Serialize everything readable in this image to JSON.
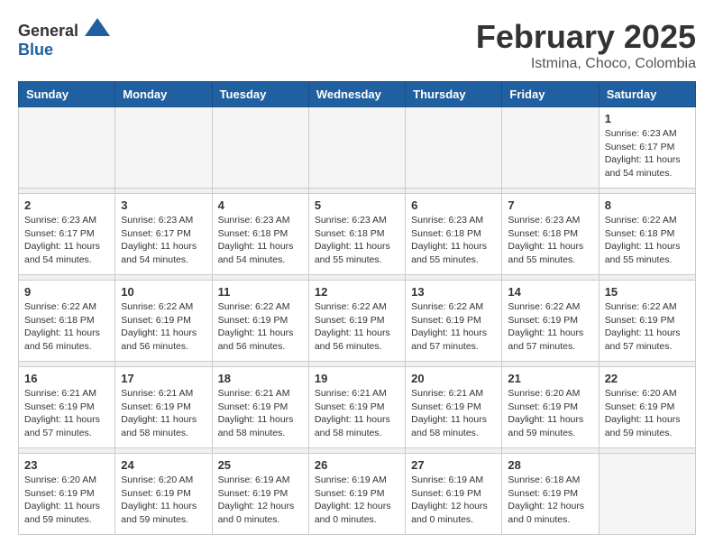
{
  "header": {
    "logo_general": "General",
    "logo_blue": "Blue",
    "title": "February 2025",
    "subtitle": "Istmina, Choco, Colombia"
  },
  "weekdays": [
    "Sunday",
    "Monday",
    "Tuesday",
    "Wednesday",
    "Thursday",
    "Friday",
    "Saturday"
  ],
  "weeks": [
    {
      "days": [
        {
          "num": "",
          "info": ""
        },
        {
          "num": "",
          "info": ""
        },
        {
          "num": "",
          "info": ""
        },
        {
          "num": "",
          "info": ""
        },
        {
          "num": "",
          "info": ""
        },
        {
          "num": "",
          "info": ""
        },
        {
          "num": "1",
          "info": "Sunrise: 6:23 AM\nSunset: 6:17 PM\nDaylight: 11 hours\nand 54 minutes."
        }
      ]
    },
    {
      "days": [
        {
          "num": "2",
          "info": "Sunrise: 6:23 AM\nSunset: 6:17 PM\nDaylight: 11 hours\nand 54 minutes."
        },
        {
          "num": "3",
          "info": "Sunrise: 6:23 AM\nSunset: 6:17 PM\nDaylight: 11 hours\nand 54 minutes."
        },
        {
          "num": "4",
          "info": "Sunrise: 6:23 AM\nSunset: 6:18 PM\nDaylight: 11 hours\nand 54 minutes."
        },
        {
          "num": "5",
          "info": "Sunrise: 6:23 AM\nSunset: 6:18 PM\nDaylight: 11 hours\nand 55 minutes."
        },
        {
          "num": "6",
          "info": "Sunrise: 6:23 AM\nSunset: 6:18 PM\nDaylight: 11 hours\nand 55 minutes."
        },
        {
          "num": "7",
          "info": "Sunrise: 6:23 AM\nSunset: 6:18 PM\nDaylight: 11 hours\nand 55 minutes."
        },
        {
          "num": "8",
          "info": "Sunrise: 6:22 AM\nSunset: 6:18 PM\nDaylight: 11 hours\nand 55 minutes."
        }
      ]
    },
    {
      "days": [
        {
          "num": "9",
          "info": "Sunrise: 6:22 AM\nSunset: 6:18 PM\nDaylight: 11 hours\nand 56 minutes."
        },
        {
          "num": "10",
          "info": "Sunrise: 6:22 AM\nSunset: 6:19 PM\nDaylight: 11 hours\nand 56 minutes."
        },
        {
          "num": "11",
          "info": "Sunrise: 6:22 AM\nSunset: 6:19 PM\nDaylight: 11 hours\nand 56 minutes."
        },
        {
          "num": "12",
          "info": "Sunrise: 6:22 AM\nSunset: 6:19 PM\nDaylight: 11 hours\nand 56 minutes."
        },
        {
          "num": "13",
          "info": "Sunrise: 6:22 AM\nSunset: 6:19 PM\nDaylight: 11 hours\nand 57 minutes."
        },
        {
          "num": "14",
          "info": "Sunrise: 6:22 AM\nSunset: 6:19 PM\nDaylight: 11 hours\nand 57 minutes."
        },
        {
          "num": "15",
          "info": "Sunrise: 6:22 AM\nSunset: 6:19 PM\nDaylight: 11 hours\nand 57 minutes."
        }
      ]
    },
    {
      "days": [
        {
          "num": "16",
          "info": "Sunrise: 6:21 AM\nSunset: 6:19 PM\nDaylight: 11 hours\nand 57 minutes."
        },
        {
          "num": "17",
          "info": "Sunrise: 6:21 AM\nSunset: 6:19 PM\nDaylight: 11 hours\nand 58 minutes."
        },
        {
          "num": "18",
          "info": "Sunrise: 6:21 AM\nSunset: 6:19 PM\nDaylight: 11 hours\nand 58 minutes."
        },
        {
          "num": "19",
          "info": "Sunrise: 6:21 AM\nSunset: 6:19 PM\nDaylight: 11 hours\nand 58 minutes."
        },
        {
          "num": "20",
          "info": "Sunrise: 6:21 AM\nSunset: 6:19 PM\nDaylight: 11 hours\nand 58 minutes."
        },
        {
          "num": "21",
          "info": "Sunrise: 6:20 AM\nSunset: 6:19 PM\nDaylight: 11 hours\nand 59 minutes."
        },
        {
          "num": "22",
          "info": "Sunrise: 6:20 AM\nSunset: 6:19 PM\nDaylight: 11 hours\nand 59 minutes."
        }
      ]
    },
    {
      "days": [
        {
          "num": "23",
          "info": "Sunrise: 6:20 AM\nSunset: 6:19 PM\nDaylight: 11 hours\nand 59 minutes."
        },
        {
          "num": "24",
          "info": "Sunrise: 6:20 AM\nSunset: 6:19 PM\nDaylight: 11 hours\nand 59 minutes."
        },
        {
          "num": "25",
          "info": "Sunrise: 6:19 AM\nSunset: 6:19 PM\nDaylight: 12 hours\nand 0 minutes."
        },
        {
          "num": "26",
          "info": "Sunrise: 6:19 AM\nSunset: 6:19 PM\nDaylight: 12 hours\nand 0 minutes."
        },
        {
          "num": "27",
          "info": "Sunrise: 6:19 AM\nSunset: 6:19 PM\nDaylight: 12 hours\nand 0 minutes."
        },
        {
          "num": "28",
          "info": "Sunrise: 6:18 AM\nSunset: 6:19 PM\nDaylight: 12 hours\nand 0 minutes."
        },
        {
          "num": "",
          "info": ""
        }
      ]
    }
  ]
}
